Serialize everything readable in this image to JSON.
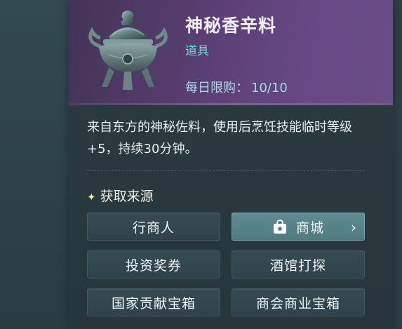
{
  "item": {
    "name": "神秘香辛料",
    "type": "道具",
    "daily_limit_label": "每日限购：",
    "daily_limit_value": "10/10",
    "icon": "incense-censer-icon"
  },
  "description": "来自东方的神秘佐料，使用后烹饪技能临时等级+5，持续30分钟。",
  "sources": {
    "title": "获取来源",
    "title_icon": "sparkle-icon",
    "buttons": [
      {
        "label": "行商人",
        "active": false
      },
      {
        "label": "商城",
        "active": true,
        "icon": "shop-bag-icon",
        "trailing_icon": "chevron-right-icon"
      },
      {
        "label": "投资奖券",
        "active": false
      },
      {
        "label": "酒馆打探",
        "active": false
      },
      {
        "label": "国家贡献宝箱",
        "active": false
      },
      {
        "label": "商会商业宝箱",
        "active": false
      }
    ]
  },
  "colors": {
    "header_purple": "#5b3f75",
    "type_teal": "#5fe0c9",
    "limit_blue": "#a9d9e6",
    "active_button": "#5f8c93"
  }
}
